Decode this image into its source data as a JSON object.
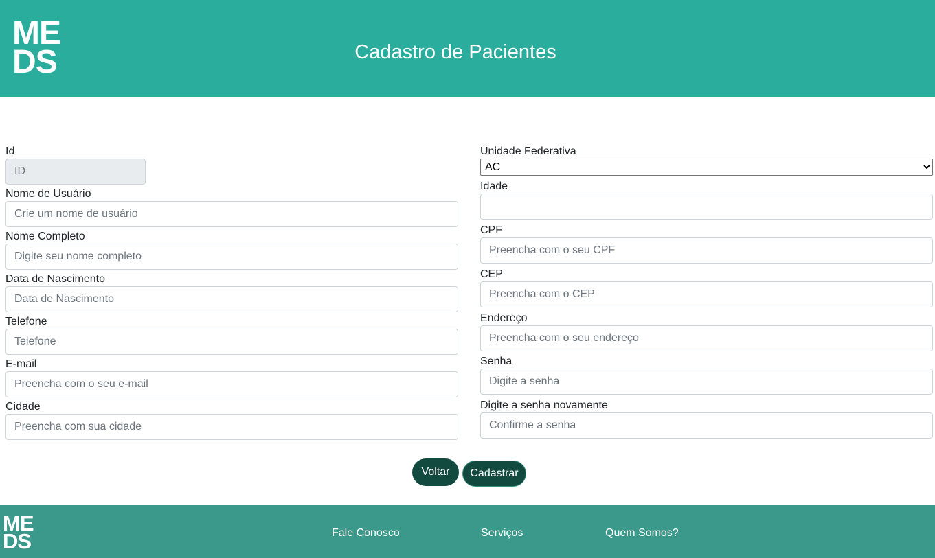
{
  "header": {
    "logo_line1": "ME",
    "logo_line2": "DS",
    "title": "Cadastro de Pacientes"
  },
  "form": {
    "left": {
      "id": {
        "label": "Id",
        "placeholder": "ID"
      },
      "username": {
        "label": "Nome de Usuário",
        "placeholder": "Crie um nome de usuário"
      },
      "fullname": {
        "label": "Nome Completo",
        "placeholder": "Digite seu nome completo"
      },
      "birthdate": {
        "label": "Data de Nascimento",
        "placeholder": "Data de Nascimento"
      },
      "phone": {
        "label": "Telefone",
        "placeholder": "Telefone"
      },
      "email": {
        "label": "E-mail",
        "placeholder": "Preencha com o seu e-mail"
      },
      "city": {
        "label": "Cidade",
        "placeholder": "Preencha com sua cidade"
      }
    },
    "right": {
      "uf": {
        "label": "Unidade Federativa",
        "selected": "AC"
      },
      "age": {
        "label": "Idade",
        "placeholder": ""
      },
      "cpf": {
        "label": "CPF",
        "placeholder": "Preencha com o seu CPF"
      },
      "cep": {
        "label": "CEP",
        "placeholder": "Preencha com o CEP"
      },
      "address": {
        "label": "Endereço",
        "placeholder": "Preencha com o seu endereço"
      },
      "password": {
        "label": "Senha",
        "placeholder": "Digite a senha"
      },
      "password_confirm": {
        "label": "Digite a senha novamente",
        "placeholder": "Confirme a senha"
      }
    }
  },
  "buttons": {
    "back": "Voltar",
    "submit": "Cadastrar"
  },
  "footer": {
    "logo_line1": "ME",
    "logo_line2": "DS",
    "links": [
      "Fale Conosco",
      "Serviços",
      "Quem Somos?"
    ]
  },
  "colors": {
    "header_bg": "#2aad9c",
    "footer_bg": "#3b998b",
    "button_bg": "#124a40"
  }
}
